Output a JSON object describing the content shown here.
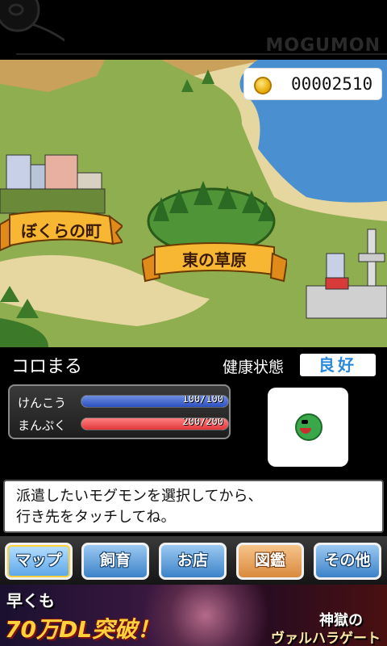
{
  "header": {
    "brand": "MOGUMON"
  },
  "map": {
    "coins": "00002510",
    "locations": [
      {
        "label": "ぼくらの町"
      },
      {
        "label": "東の草原"
      }
    ]
  },
  "status": {
    "pet_name": "コロまる",
    "health_label": "健康状態",
    "health_value": "良好",
    "bars": [
      {
        "label": "けんこう",
        "value_text": "100/100",
        "fraction": 1.0,
        "color": "#2b4fbf"
      },
      {
        "label": "まんぷく",
        "value_text": "200/200",
        "fraction": 1.0,
        "color": "#e0373a"
      }
    ]
  },
  "message": {
    "line1": "派遣したいモグモンを選択してから、",
    "line2": "行き先をタッチしてね。"
  },
  "nav": {
    "map": "マップ",
    "breeding": "飼育",
    "shop": "お店",
    "encyclopedia": "図鑑",
    "other": "その他"
  },
  "ad": {
    "line1": "早くも",
    "line2": "70万DL突破！",
    "right1": "神獄の",
    "right2": "ヴァルハラゲート"
  }
}
